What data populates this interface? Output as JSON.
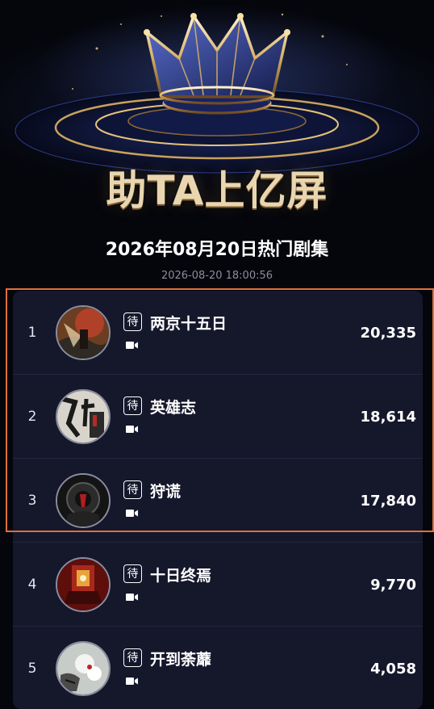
{
  "banner": {
    "title": "助TA上亿屏",
    "heading": "2026年08月20日热门剧集",
    "timestamp": "2026-08-20 18:00:56"
  },
  "icons": {
    "crown": "crown-icon",
    "status_badge": "待",
    "video": "video-camera-icon"
  },
  "colors": {
    "highlight_border": "#e0703a",
    "list_background": "#15172b",
    "title_gold": "#e9d6b0"
  },
  "rankings": [
    {
      "rank": "1",
      "title": "两京十五日",
      "badge": "待",
      "score": "20,335"
    },
    {
      "rank": "2",
      "title": "英雄志",
      "badge": "待",
      "score": "18,614"
    },
    {
      "rank": "3",
      "title": "狩谎",
      "badge": "待",
      "score": "17,840"
    },
    {
      "rank": "4",
      "title": "十日终焉",
      "badge": "待",
      "score": "9,770"
    },
    {
      "rank": "5",
      "title": "开到荼蘼",
      "badge": "待",
      "score": "4,058"
    }
  ]
}
